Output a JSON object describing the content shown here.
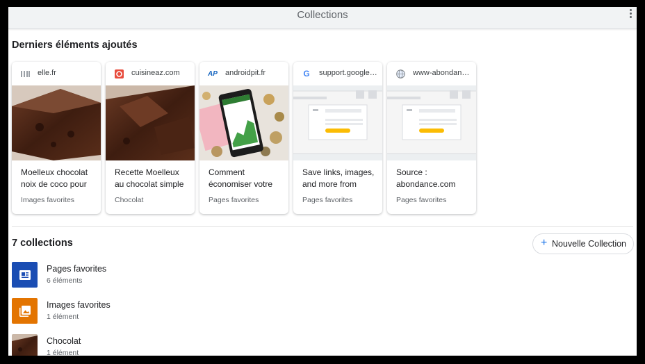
{
  "app": {
    "title": "Collections",
    "menu_icon": "more-vert-icon"
  },
  "recent": {
    "title": "Derniers éléments ajoutés",
    "cards": [
      {
        "domain": "elle.fr",
        "favicon": "elle-favicon",
        "description": "Moelleux chocolat noix de coco pour",
        "collection": "Images favorites",
        "thumb": "brownie-photo"
      },
      {
        "domain": "cuisineaz.com",
        "favicon": "cuisineaz-favicon",
        "description": "Recette Moelleux au chocolat simple",
        "collection": "Chocolat",
        "thumb": "brownie-photo"
      },
      {
        "domain": "androidpit.fr",
        "favicon": "androidpit-favicon",
        "favicon_text": "AP",
        "description": "Comment économiser votre",
        "collection": "Pages favorites",
        "thumb": "phone-coins-photo"
      },
      {
        "domain": "support.google.…",
        "favicon": "google-favicon",
        "favicon_text": "G",
        "description": "Save links, images, and more from",
        "collection": "Pages favorites",
        "thumb": "webpage-placeholder"
      },
      {
        "domain": "www-abondanc…",
        "favicon": "globe-favicon",
        "description": "Source : abondance.com",
        "collection": "Pages favorites",
        "thumb": "webpage-placeholder"
      }
    ]
  },
  "collections": {
    "title": "7 collections",
    "new_button": {
      "label": "Nouvelle Collection",
      "icon": "plus-icon"
    },
    "items": [
      {
        "name": "Pages favorites",
        "count": "6 éléments",
        "color": "#1a4db3",
        "icon": "article-icon"
      },
      {
        "name": "Images favorites",
        "count": "1 élément",
        "color": "#e37400",
        "icon": "image-icon"
      },
      {
        "name": "Chocolat",
        "count": "1 élément",
        "icon": "brownie-thumb"
      }
    ]
  },
  "colors": {
    "accent": "#1a73e8",
    "google_yellow": "#fbbc04"
  }
}
